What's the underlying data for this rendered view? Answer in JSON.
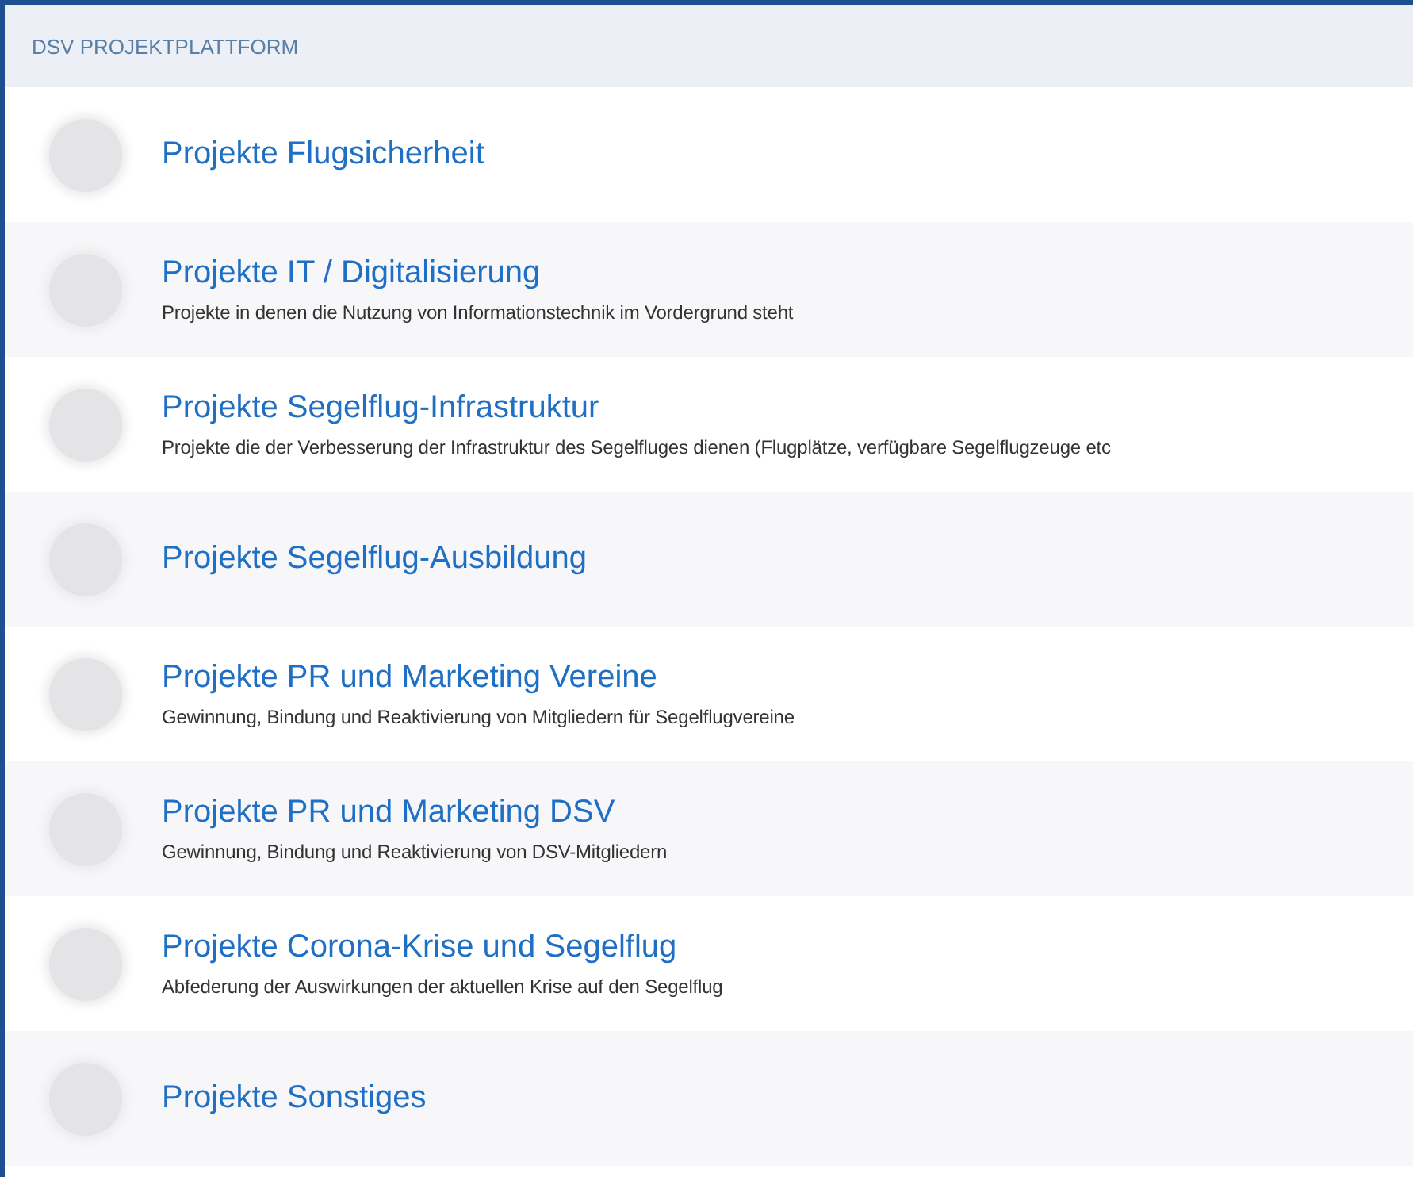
{
  "header": {
    "title": "DSV PROJEKTPLATTFORM"
  },
  "categories": [
    {
      "title": "Projekte Flugsicherheit"
    },
    {
      "title": "Projekte IT / Digitalisierung",
      "description": "Projekte in denen die Nutzung von Informationstechnik im Vordergrund steht"
    },
    {
      "title": "Projekte Segelflug-Infrastruktur",
      "description": "Projekte die der Verbesserung der Infrastruktur des Segelfluges dienen (Flugplätze, verfügbare Segelflugzeuge etc"
    },
    {
      "title": "Projekte Segelflug-Ausbildung"
    },
    {
      "title": "Projekte PR und Marketing Vereine",
      "description": "Gewinnung, Bindung und Reaktivierung von Mitgliedern für Segelflugvereine"
    },
    {
      "title": "Projekte PR und Marketing DSV",
      "description": "Gewinnung, Bindung und Reaktivierung von DSV-Mitgliedern"
    },
    {
      "title": "Projekte Corona-Krise und Segelflug",
      "description": "Abfederung der Auswirkungen der aktuellen Krise auf den Segelflug"
    },
    {
      "title": "Projekte Sonstiges"
    }
  ]
}
